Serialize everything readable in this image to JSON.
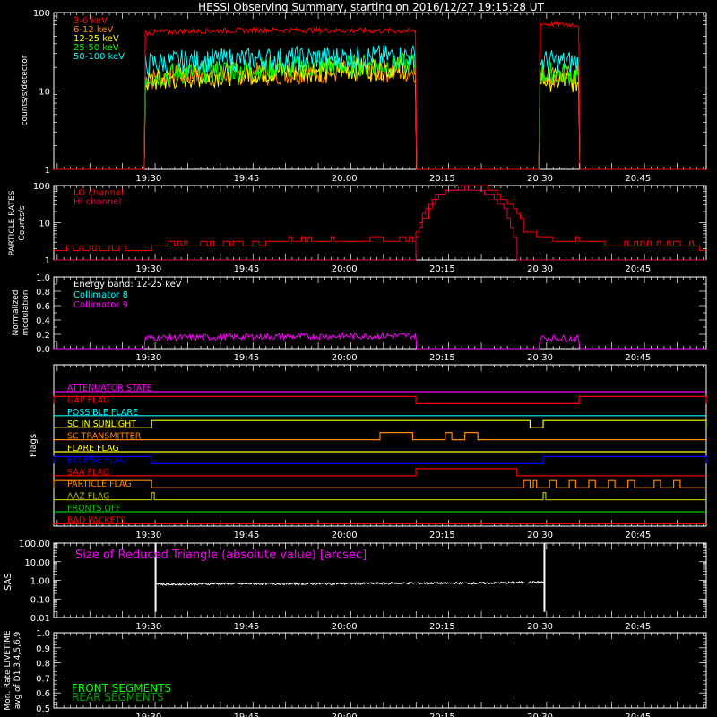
{
  "title": "HESSI Observing Summary, starting on 2016/12/27 19:15:28 UT",
  "time_ticks": [
    "19:30",
    "19:45",
    "20:00",
    "20:15",
    "20:30",
    "20:45"
  ],
  "colors": {
    "frame": "#ffffff",
    "c1": "#ff0000",
    "c2": "#ff8800",
    "c3": "#ffff00",
    "c4": "#00ff00",
    "c5": "#00ffff",
    "magenta": "#ff00ff",
    "lo": "#ff0000",
    "hi": "#e0004a",
    "blue": "#0000ff",
    "green": "#00c800",
    "olive": "#b4b400"
  },
  "chart_data": [
    {
      "type": "line",
      "name": "count-rates",
      "ylabel": "counts/s/detector",
      "yscale": "log",
      "ylim": [
        1,
        100
      ],
      "y_ticks": [
        "1",
        "10",
        "100"
      ],
      "x_unit": "minutes after 19:15:28",
      "gaps": [
        [
          0,
          14
        ],
        [
          55.5,
          74.5
        ],
        [
          80.5,
          100
        ]
      ],
      "legend": [
        {
          "label": "3-6 keV",
          "color": "#ff0000"
        },
        {
          "label": "6-12 keV",
          "color": "#ff8800"
        },
        {
          "label": "12-25 keV",
          "color": "#ffff00"
        },
        {
          "label": "25-50 keV",
          "color": "#00ff00"
        },
        {
          "label": "50-100 keV",
          "color": "#00ffff"
        }
      ],
      "series": [
        {
          "name": "3-6 keV",
          "color": "#ff0000",
          "x": [
            14,
            20,
            35,
            55.5,
            74.5,
            80.5
          ],
          "y": [
            55,
            58,
            60,
            58,
            72,
            70
          ]
        },
        {
          "name": "6-12 keV",
          "color": "#ff8800",
          "x": [
            14,
            20,
            35,
            55.5,
            74.5,
            80.5
          ],
          "y": [
            14,
            16,
            17,
            18,
            16,
            15
          ]
        },
        {
          "name": "12-25 keV",
          "color": "#ffff00",
          "x": [
            14,
            20,
            35,
            55.5,
            74.5,
            80.5
          ],
          "y": [
            13,
            15,
            18,
            20,
            14,
            13
          ]
        },
        {
          "name": "25-50 keV",
          "color": "#00ff00",
          "x": [
            14,
            20,
            35,
            55.5,
            74.5,
            80.5
          ],
          "y": [
            15,
            17,
            20,
            22,
            17,
            16
          ]
        },
        {
          "name": "50-100 keV",
          "color": "#00ffff",
          "x": [
            14,
            20,
            35,
            55.5,
            74.5,
            80.5
          ],
          "y": [
            22,
            24,
            26,
            28,
            24,
            23
          ]
        }
      ]
    },
    {
      "type": "line",
      "name": "particle-rates",
      "ylabel": "PARTICLE RATES Counts/s",
      "yscale": "log",
      "ylim": [
        1,
        100
      ],
      "y_ticks": [
        "1",
        "10",
        "100"
      ],
      "legend": [
        {
          "label": "LO channel",
          "color": "#ff0000"
        },
        {
          "label": "HI channel",
          "color": "#e0004a"
        }
      ],
      "series": [
        {
          "name": "LO channel",
          "color": "#ff0000",
          "x": [
            0,
            14,
            25,
            40,
            55,
            57,
            60,
            63,
            66,
            69,
            72,
            75,
            78,
            100
          ],
          "y": [
            2,
            2,
            2.5,
            3,
            3,
            15,
            70,
            100,
            90,
            40,
            6,
            4,
            3,
            2
          ]
        },
        {
          "name": "HI channel",
          "color": "#e0004a",
          "x": [
            0,
            55,
            56,
            59,
            63,
            67,
            70,
            71,
            100
          ],
          "y": [
            1,
            1,
            8,
            60,
            90,
            50,
            8,
            1,
            1
          ]
        }
      ]
    },
    {
      "type": "line",
      "name": "modulation",
      "ylabel": "Normalized modulation",
      "ylim": [
        0,
        1
      ],
      "y_ticks": [
        "0.0",
        "0.2",
        "0.4",
        "0.6",
        "0.8",
        "1.0"
      ],
      "legend_title": "Energy band: 12-25 keV",
      "legend": [
        {
          "label": "Collimator 8",
          "color": "#00ffff"
        },
        {
          "label": "Collimator 9",
          "color": "#ff00ff"
        }
      ],
      "series": [
        {
          "name": "Collimator 9",
          "color": "#ff00ff",
          "x": [
            14,
            35,
            55.5,
            74.5,
            80.5
          ],
          "y": [
            0.15,
            0.17,
            0.18,
            0.15,
            0.14
          ]
        }
      ]
    },
    {
      "type": "line",
      "name": "flags",
      "ylabel": "Flags",
      "flags": [
        {
          "label": "ATTENUATOR STATE",
          "color": "#ff00ff",
          "high": []
        },
        {
          "label": "GAP FLAG",
          "color": "#ff0000",
          "high": [
            [
              0,
              55.5
            ],
            [
              80.5,
              100
            ]
          ]
        },
        {
          "label": "POSSIBLE FLARE",
          "color": "#00ffff",
          "high": []
        },
        {
          "label": "SC IN SUNLIGHT",
          "color": "#ffff00",
          "high": [
            [
              15,
              73
            ],
            [
              75,
              100
            ]
          ]
        },
        {
          "label": "SC TRANSMITTER",
          "color": "#ff8800",
          "high": [
            [
              50,
              55
            ],
            [
              60,
              61
            ],
            [
              63,
              65
            ]
          ]
        },
        {
          "label": "FLARE FLAG",
          "color": "#ffff00",
          "high": []
        },
        {
          "label": "ECLIPSE FLAG",
          "color": "#0000ff",
          "high": [
            [
              0,
              15
            ],
            [
              75,
              100
            ]
          ]
        },
        {
          "label": "SAA FLAG",
          "color": "#ff0000",
          "high": [
            [
              55.5,
              71
            ]
          ]
        },
        {
          "label": "PARTICLE FLAG",
          "color": "#ff8800",
          "high": [
            [
              0,
              15
            ],
            [
              72,
              73
            ],
            [
              73.5,
              74
            ],
            [
              76,
              77
            ],
            [
              79,
              80
            ],
            [
              82,
              83
            ],
            [
              85,
              86
            ],
            [
              88,
              89
            ],
            [
              92,
              93
            ],
            [
              95,
              96
            ]
          ]
        },
        {
          "label": "AAZ FLAG",
          "color": "#b4b400",
          "high": [
            [
              15,
              15.4
            ],
            [
              75,
              75.4
            ]
          ]
        },
        {
          "label": "FRONTS OFF",
          "color": "#00c800",
          "high": []
        },
        {
          "label": "BAD PACKETS",
          "color": "#ff0000",
          "high": []
        }
      ]
    },
    {
      "type": "line",
      "name": "sas",
      "ylabel": "SAS",
      "yscale": "log",
      "y_ticks": [
        "0.01",
        "0.10",
        "1.00",
        "10.00",
        "100.00"
      ],
      "annotation": "Size of Reduced Triangle (absolute value) [arcsec]",
      "series": [
        {
          "name": "triangle",
          "color": "#ffffff",
          "x": [
            15.5,
            17,
            25,
            40,
            55,
            65,
            75
          ],
          "y": [
            0.7,
            0.6,
            0.65,
            0.65,
            0.7,
            0.7,
            0.8
          ]
        }
      ]
    },
    {
      "type": "line",
      "name": "livetime",
      "ylabel": "Mon. Rate LIVETIME avg of D1,3,4,5,6,9",
      "ylim": [
        0.5,
        1.0
      ],
      "y_ticks": [
        "0.5",
        "0.6",
        "0.7",
        "0.8",
        "0.9",
        "1.0"
      ],
      "legend": [
        {
          "label": "FRONT SEGMENTS",
          "color": "#00ff00"
        },
        {
          "label": "REAR SEGMENTS",
          "color": "#00a000"
        }
      ]
    }
  ]
}
